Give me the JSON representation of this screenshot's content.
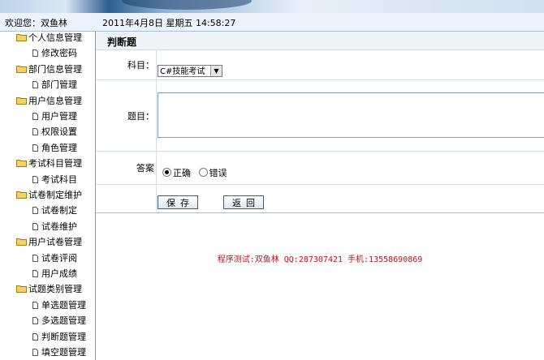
{
  "header": {
    "welcome": "欢迎您：双鱼林",
    "datetime": "2011年4月8日  星期五  14:58:27"
  },
  "sidebar": {
    "items": [
      {
        "label": "个人信息管理",
        "level": 0
      },
      {
        "label": "修改密码",
        "level": 1
      },
      {
        "label": "部门信息管理",
        "level": 0
      },
      {
        "label": "部门管理",
        "level": 1
      },
      {
        "label": "用户信息管理",
        "level": 0
      },
      {
        "label": "用户管理",
        "level": 1
      },
      {
        "label": "权限设置",
        "level": 1
      },
      {
        "label": "角色管理",
        "level": 1
      },
      {
        "label": "考试科目管理",
        "level": 0
      },
      {
        "label": "考试科目",
        "level": 1
      },
      {
        "label": "试卷制定维护",
        "level": 0
      },
      {
        "label": "试卷制定",
        "level": 1
      },
      {
        "label": "试卷维护",
        "level": 1
      },
      {
        "label": "用户试卷管理",
        "level": 0
      },
      {
        "label": "试卷评阅",
        "level": 1
      },
      {
        "label": "用户成绩",
        "level": 1
      },
      {
        "label": "试题类别管理",
        "level": 0
      },
      {
        "label": "单选题管理",
        "level": 1
      },
      {
        "label": "多选题管理",
        "level": 1
      },
      {
        "label": "判断题管理",
        "level": 1
      },
      {
        "label": "填空题管理",
        "level": 1
      }
    ]
  },
  "main": {
    "title": "判断题",
    "subject_label": "科目：",
    "subject_value": "C#技能考试",
    "question_label": "题目：",
    "answer_label": "答案",
    "answer_true": "正确",
    "answer_false": "错误",
    "save_label": "保存",
    "back_label": "返回",
    "footer": "程序测试:双鱼林 QQ:287307421 手机:13558690869"
  },
  "colors": {
    "accent": "#3c5d86",
    "footer_text": "#c0101c",
    "folder": "#e8c24a"
  }
}
